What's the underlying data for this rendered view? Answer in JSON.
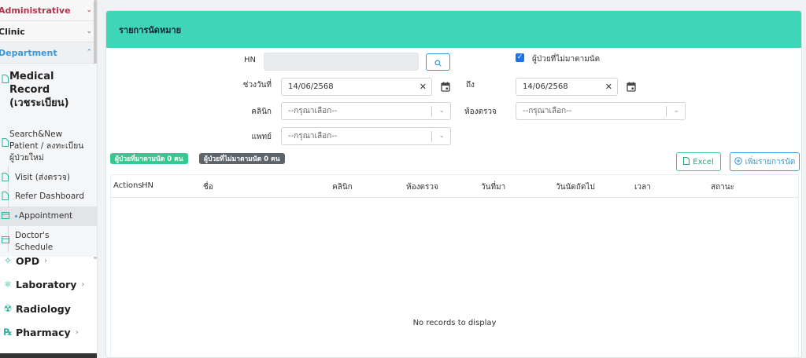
{
  "sidebar": {
    "administrative": "Administrative",
    "clinic": "Clinic",
    "department": "Department",
    "medical_record_line1": "Medical Record",
    "medical_record_line2": "(เวชระเบียน)",
    "sub_items": [
      {
        "line1": "Search&New",
        "line2": "Patient / ลงทะเบียน",
        "line3": "ผู้ป่วยใหม่"
      },
      {
        "label": "Visit (ส่งตรวจ)"
      },
      {
        "label": "Refer Dashboard"
      },
      {
        "label": "Appointment"
      },
      {
        "line1": "Doctor's",
        "line2": "Schedule"
      }
    ],
    "main_items": [
      {
        "label": "OPD",
        "icon": "stethoscope-icon"
      },
      {
        "label": "Laboratory",
        "icon": "microscope-icon"
      },
      {
        "label": "Radiology",
        "icon": "radiation-icon"
      },
      {
        "label": "Pharmacy",
        "icon": "prescription-icon"
      }
    ]
  },
  "panel": {
    "title": "รายการนัดหมาย",
    "hn_label": "HN",
    "hn_value": "",
    "no_show_label": "ผู้ป่วยที่ไม่มาตามนัด",
    "no_show_checked": true,
    "date_range_label": "ช่วงวันที่",
    "date_from": "14/06/2568",
    "to_label": "ถึง",
    "date_to": "14/06/2568",
    "clinic_label": "คลินิก",
    "clinic_placeholder": "--กรุณาเลือก--",
    "room_label": "ห้องตรวจ",
    "room_placeholder": "--กรุณาเลือก--",
    "doctor_label": "แพทย์",
    "doctor_placeholder": "--กรุณาเลือก--",
    "badge_came": "ผู้ป่วยที่มาตามนัด 0 คน",
    "badge_not_came": "ผู้ป่วยที่ไม่มาตามนัด 0 คน",
    "excel_label": "Excel",
    "add_label": "เพิ่มรายการนัด"
  },
  "table": {
    "columns": [
      "Actions",
      "HN",
      "ชื่อ",
      "คลินิก",
      "ห้องตรวจ",
      "วันที่มา",
      "วันนัดถัดไป",
      "เวลา",
      "สถานะ"
    ],
    "empty_text": "No records to display"
  },
  "colors": {
    "header_teal": "#3fd6b7",
    "accent_blue": "#3a97d8",
    "badge_green": "#36c98f",
    "badge_gray": "#5b636b",
    "admin_red": "#b8324a"
  }
}
